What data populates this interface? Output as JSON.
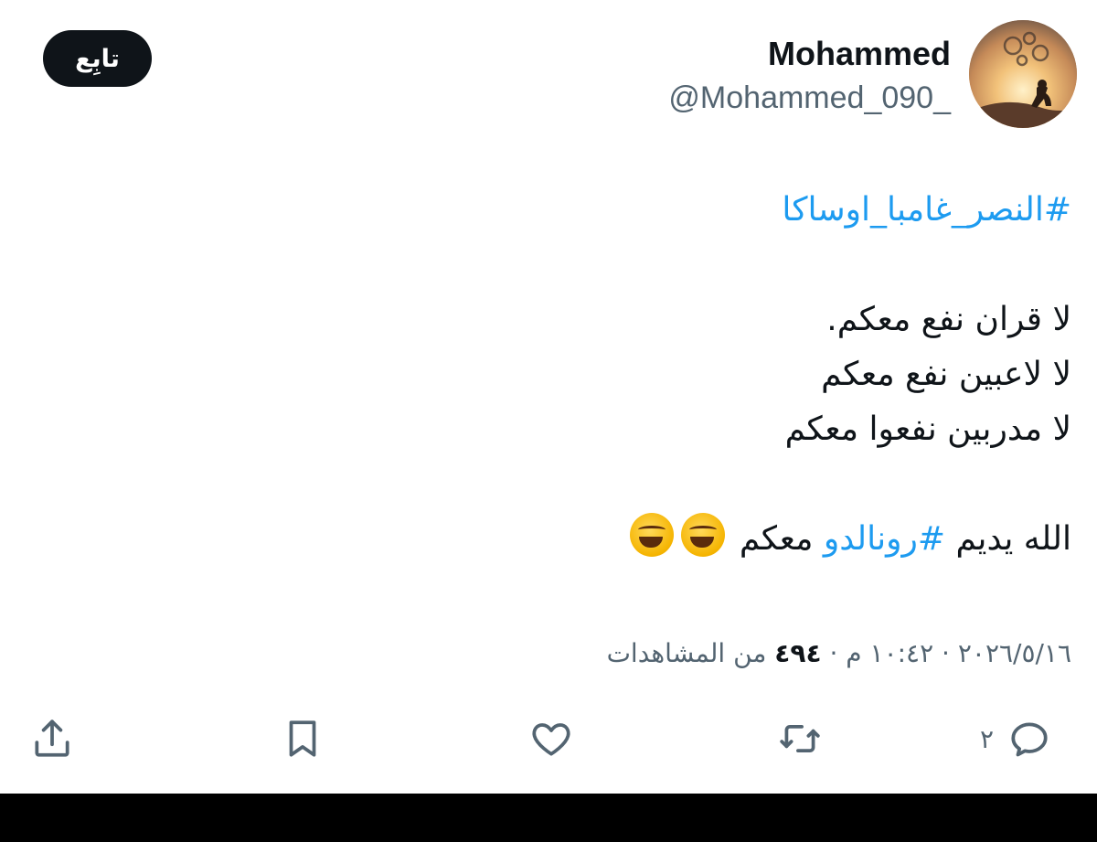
{
  "header": {
    "display_name": "Mohammed",
    "handle": "@Mohammed_090_",
    "follow_label": "تابِع"
  },
  "tweet": {
    "hashtag_line": "#النصر_غامبا_اوساكا",
    "line1": "لا قران نفع معكم.",
    "line2": "لا لاعبين نفع معكم",
    "line3": "لا مدربين نفعوا معكم",
    "last_prefix": "الله يديم",
    "last_hashtag": "#رونالدو",
    "last_suffix": "معكم",
    "emoji_icon": "rolling-on-the-floor-laughing-emoji"
  },
  "meta": {
    "date": "٢٠٢٦/٥/١٦",
    "time": "١٠:٤٢ م",
    "views_count": "٤٩٤",
    "views_label": "من المشاهدات",
    "separator": "·"
  },
  "actions": {
    "reply_count": "٢",
    "icons": [
      "reply-icon",
      "retweet-icon",
      "like-icon",
      "bookmark-icon",
      "share-icon"
    ]
  },
  "colors": {
    "hashtag": "#1d9bf0",
    "text": "#0f1419",
    "secondary": "#536471",
    "button_bg": "#0f1419"
  }
}
